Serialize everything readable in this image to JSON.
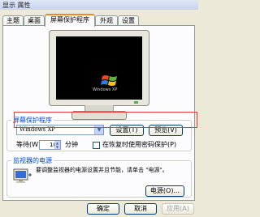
{
  "window": {
    "title": "显示 属性"
  },
  "tabs": [
    {
      "label": "主题"
    },
    {
      "label": "桌面"
    },
    {
      "label": "屏幕保护程序"
    },
    {
      "label": "外观"
    },
    {
      "label": "设置"
    }
  ],
  "active_tab": "屏幕保护程序",
  "preview": {
    "logo_text": "Windows XP"
  },
  "screensaver_group": {
    "legend": "屏幕保护程序",
    "selected": "Windows XP",
    "settings_button": "设置(T)",
    "preview_button": "预览(V)",
    "wait_label": "等待(W):",
    "wait_value": "10",
    "wait_unit": "分钟",
    "password_checkbox_label": "在恢复时使用密码保护(P)",
    "password_checked": false
  },
  "power_group": {
    "legend": "监视器的电源",
    "description": "要调整监视器的电源设置并且节能，请单击 \"电源\"。",
    "power_button": "电源(O)..."
  },
  "footer": {
    "ok": "确定",
    "cancel": "取消",
    "apply": "应用(A)"
  },
  "colors": {
    "accent_tab": "#e68b2c",
    "legend_blue": "#0046d5",
    "highlight_red": "#e83a3a",
    "dialog_bg": "#ece9d8"
  }
}
